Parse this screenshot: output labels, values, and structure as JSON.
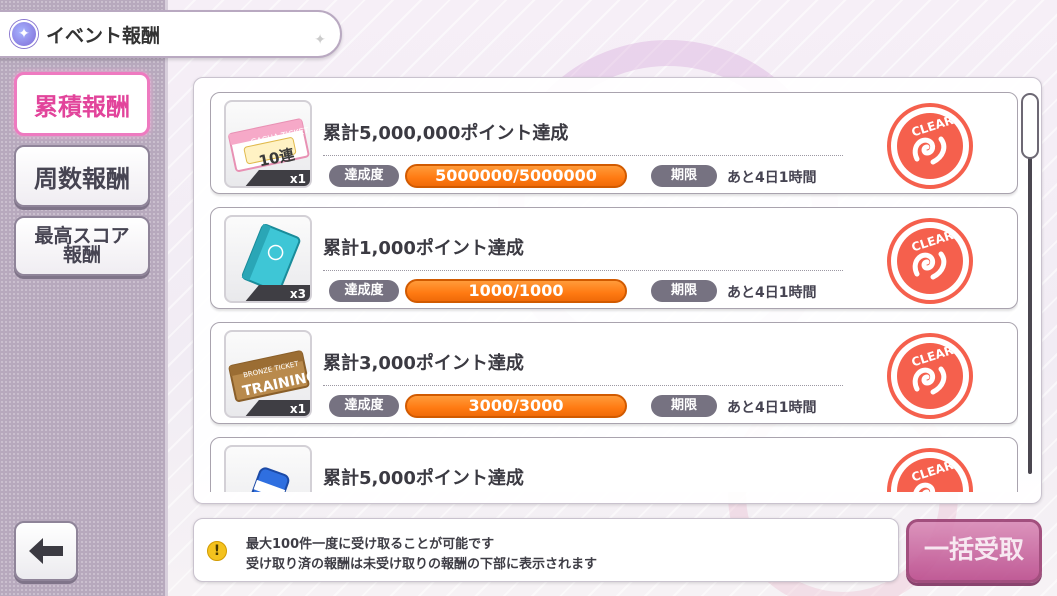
{
  "header": {
    "title": "イベント報酬"
  },
  "sidebar": {
    "tabs": [
      {
        "label": "累積報酬"
      },
      {
        "label": "周数報酬"
      },
      {
        "label": "最高スコア",
        "label2": "報酬"
      }
    ]
  },
  "rewards": [
    {
      "title": "累計5,000,000ポイント達成",
      "achievement_label": "達成度",
      "progress_text": "5000000/5000000",
      "progress": 1.0,
      "deadline_label": "期限",
      "deadline": "あと4日1時間",
      "qty": "x1",
      "item": "gacha-ticket",
      "ticket_text": "GACHA TICKET",
      "ticket_big": "10連",
      "stamp": "CLEAR!!"
    },
    {
      "title": "累計1,000ポイント達成",
      "achievement_label": "達成度",
      "progress_text": "1000/1000",
      "progress": 1.0,
      "deadline_label": "期限",
      "deadline": "あと4日1時間",
      "qty": "x3",
      "item": "notebook",
      "stamp": "CLEAR!!"
    },
    {
      "title": "累計3,000ポイント達成",
      "achievement_label": "達成度",
      "progress_text": "3000/3000",
      "progress": 1.0,
      "deadline_label": "期限",
      "deadline": "あと4日1時間",
      "qty": "x1",
      "item": "bronze-ticket",
      "ticket_text": "BRONZE TICKET",
      "ticket_big": "TRAINING",
      "stamp": "CLEAR!!"
    },
    {
      "title": "累計5,000ポイント達成",
      "item": "drink-can",
      "stamp": "CLEAR!!"
    }
  ],
  "info": {
    "line1": "最大100件一度に受け取ることが可能です",
    "line2": "受け取り済の報酬は未受け取りの報酬の下部に表示されます"
  },
  "claim_all_label": "一括受取",
  "colors": {
    "accent_pink": "#ee7ac0",
    "progress_orange": "#ff7a12",
    "stamp_red": "#f5604d",
    "claim_button": "#bb4c8d"
  }
}
